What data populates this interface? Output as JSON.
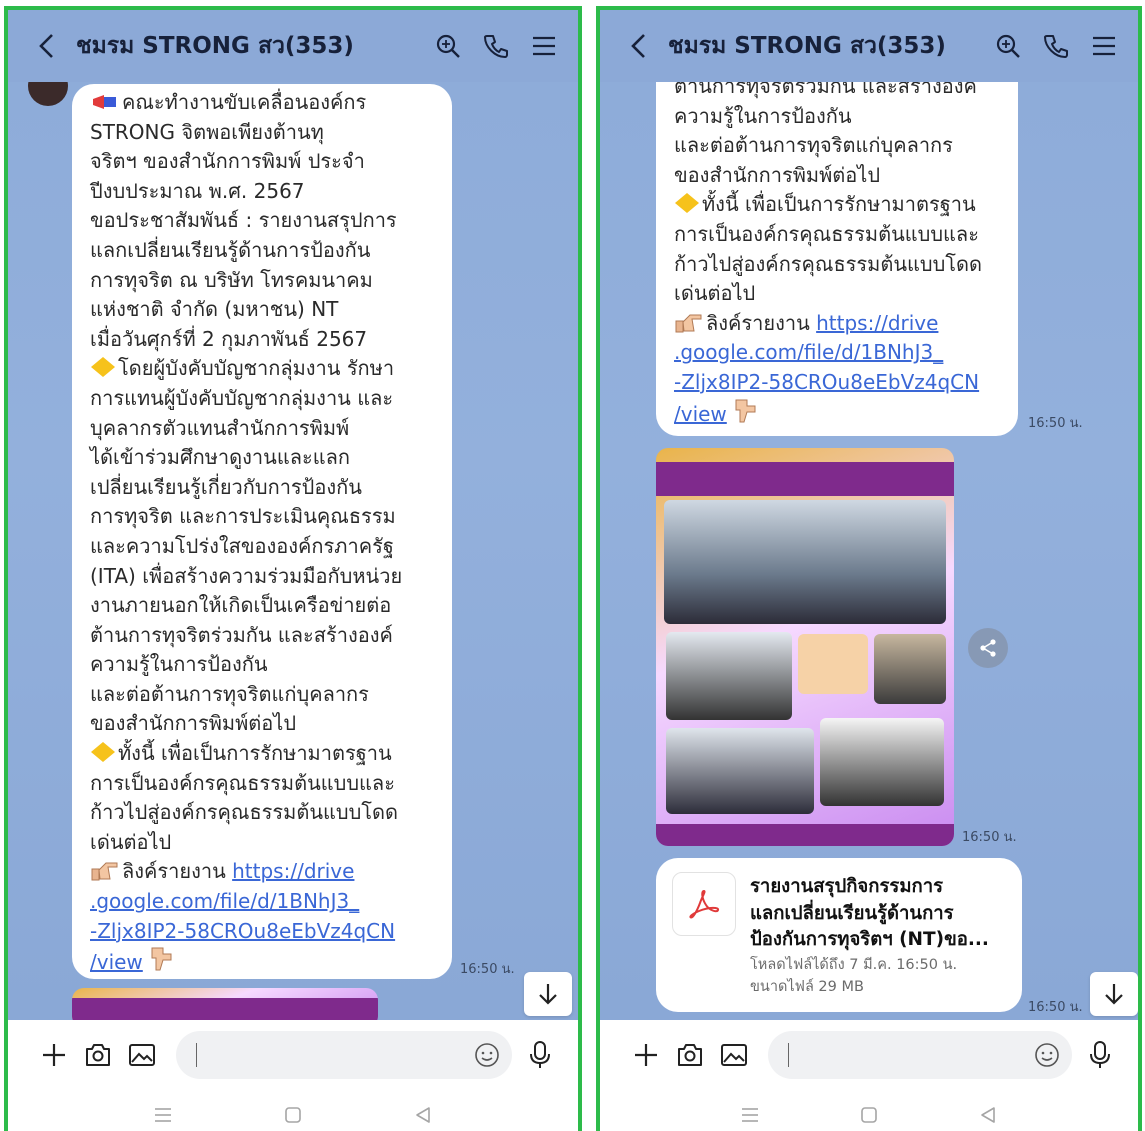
{
  "chat": {
    "title": "ชมรม STRONG สว(353)",
    "input_placeholder": ""
  },
  "left": {
    "message_lines": [
      "คณะทำงานขับเคลื่อนองค์กร",
      "STRONG จิตพอเพียงต้านทุ",
      "จริตฯ ของสำนักการพิมพ์ ประจำ",
      "ปีงบประมาณ พ.ศ. 2567",
      "ขอประชาสัมพันธ์ : รายงานสรุปการ",
      "แลกเปลี่ยนเรียนรู้ด้านการป้องกัน",
      "การทุจริต ณ บริษัท โทรคมนาคม",
      "แห่งชาติ จำกัด (มหาชน) NT",
      "เมื่อวันศุกร์ที่ 2 กุมภาพันธ์ 2567",
      "โดยผู้บังคับบัญชากลุ่มงาน รักษา",
      "การแทนผู้บังคับบัญชากลุ่มงาน และ",
      "บุคลากรตัวแทนสำนักการพิมพ์",
      "ได้เข้าร่วมศึกษาดูงานและแลก",
      "เปลี่ยนเรียนรู้เกี่ยวกับการป้องกัน",
      "การทุจริต และการประเมินคุณธรรม",
      "และความโปร่งใสขององค์กรภาครัฐ",
      "(ITA) เพื่อสร้างความร่วมมือกับหน่วย",
      "งานภายนอกให้เกิดเป็นเครือข่ายต่อ",
      "ต้านการทุจริตร่วมกัน และสร้างองค์",
      "ความรู้ในการป้องกัน",
      "และต่อต้านการทุจริตแก่บุคลากร",
      "ของสำนักการพิมพ์ต่อไป",
      "ทั้งนี้ เพื่อเป็นการรักษามาตรฐาน",
      "การเป็นองค์กรคุณธรรมต้นแบบและ",
      "ก้าวไปสู่องค์กรคุณธรรมต้นแบบโดด",
      "เด่นต่อไป"
    ],
    "link_prefix": "ลิงค์รายงาน",
    "link_lines": [
      "https://drive",
      ".google.com/file/d/1BNhJ3_",
      "-Zljx8IP2-58CROu8eEbVz4qCN",
      "/view"
    ],
    "time": "16:50 น."
  },
  "right": {
    "message_lines": [
      "ต้านการทุจริตร่วมกัน และสร้างองค์",
      "ความรู้ในการป้องกัน",
      "และต่อต้านการทุจริตแก่บุคลากร",
      "ของสำนักการพิมพ์ต่อไป",
      "ทั้งนี้ เพื่อเป็นการรักษามาตรฐาน",
      "การเป็นองค์กรคุณธรรมต้นแบบและ",
      "ก้าวไปสู่องค์กรคุณธรรมต้นแบบโดด",
      "เด่นต่อไป"
    ],
    "link_prefix": "ลิงค์รายงาน",
    "link_lines": [
      "https://drive",
      ".google.com/file/d/1BNhJ3_",
      "-Zljx8IP2-58CROu8eEbVz4qCN",
      "/view"
    ],
    "time_text": "16:50 น.",
    "time_image": "16:50 น.",
    "time_file": "16:50 น.",
    "file": {
      "title_lines": [
        "รายงานสรุปกิจกรรมการ",
        "แลกเปลี่ยนเรียนรู้ด้านการ",
        "ป้องกันการทุจริตฯ (NT)ขอ..."
      ],
      "expiry": "โหลดไฟล์ได้ถึง 7 มี.ค. 16:50 น.",
      "size": "ขนาดไฟล์ 29 MB"
    }
  },
  "colors": {
    "frame_green": "#2dbb4a",
    "chat_bg": "#8eacd9",
    "link_blue": "#3a67d6",
    "pdf_red": "#e03a3a"
  }
}
